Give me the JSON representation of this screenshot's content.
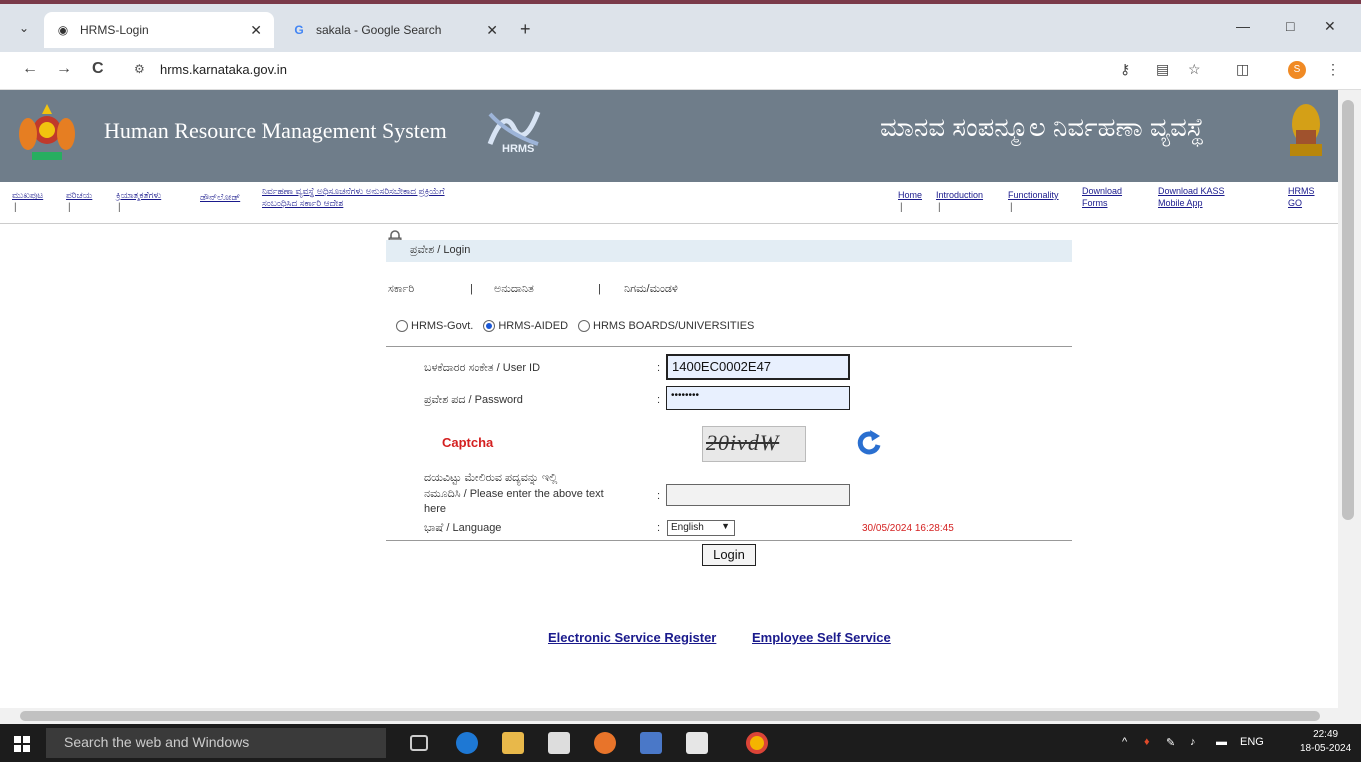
{
  "browser": {
    "tabs": [
      {
        "title": "HRMS-Login",
        "active": true
      },
      {
        "title": "sakala - Google Search",
        "active": false
      }
    ],
    "url": "hrms.karnataka.gov.in",
    "window_controls": {
      "minimize": "—",
      "maximize": "□",
      "close": "✕"
    },
    "nav": {
      "back": "←",
      "forward": "→",
      "reload": "C"
    },
    "profile_initial": "S"
  },
  "banner": {
    "title": "Human Resource Management System",
    "logo_text": "HRMS",
    "title_kannada": "ಮಾನವ ಸಂಪನ್ಮೂಲ ನಿರ್ವಹಣಾ ವ್ಯವಸ್ಥೆ"
  },
  "menu": {
    "left": [
      "ಮುಖಪುಟ",
      "ಪರಿಚಯ",
      "ಕ್ರಿಯಾತ್ಮಕತೆಗಳು",
      "ಡೌನ್‌ಲೋಡ್"
    ],
    "notice_line1": "ನಿರ್ವಹಣಾ ವ್ಯವಸ್ಥೆ ಅಧಿಸೂಚನೆಗಳು ಅನುಸರಿಸಬೇಕಾದ ಪ್ರಕ್ರಿಯೆಗೆ",
    "notice_line2": "ಸಂಬಂಧಿಸಿದ ಸರ್ಕಾರಿ ಆದೇಶ",
    "right": [
      "Home",
      "Introduction",
      "Functionality"
    ],
    "download_forms_1": "Download",
    "download_forms_2": "Forms",
    "kass_1": "Download KASS",
    "kass_2": "Mobile App",
    "hrms_go_1": "HRMS",
    "hrms_go_2": "GO"
  },
  "login": {
    "header": "ಪ್ರವೇಶ / Login",
    "categories": [
      "ಸರ್ಕಾರಿ",
      "ಅನುದಾನಿತ",
      "ನಿಗಮ/ಮಂಡಳಿ"
    ],
    "cat_sep": "|",
    "options": [
      {
        "label": "HRMS-Govt.",
        "selected": false
      },
      {
        "label": "HRMS-AIDED",
        "selected": true
      },
      {
        "label": "HRMS BOARDS/UNIVERSITIES",
        "selected": false
      }
    ],
    "user_id_label": "ಬಳಕೆದಾರರ ಸಂಕೇತ / User ID",
    "user_id_value": "1400EC0002E47",
    "password_label": "ಪ್ರವೇಶ ಪದ / Password",
    "password_value": "••••••••",
    "captcha_label": "Captcha",
    "captcha_text": "20ivdW",
    "captcha_entry_label_1": "ದಯವಿಟ್ಟು ಮೇಲಿರುವ ಪದ್ಯವನ್ನು ಇಲ್ಲಿ",
    "captcha_entry_label_2": "ನಮೂದಿಸಿ / Please enter the above text",
    "captcha_entry_label_3": "here",
    "captcha_entry_value": "",
    "language_label": "ಭಾಷೆ / Language",
    "language_selected": "English",
    "datetime": "30/05/2024 16:28:45",
    "login_button": "Login",
    "colon": ":"
  },
  "links": {
    "esr": "Electronic Service Register",
    "ess": "Employee Self Service"
  },
  "taskbar": {
    "search_placeholder": "Search the web and Windows",
    "lang": "ENG",
    "time": "22:49",
    "date": "18-05-2024"
  },
  "colors": {
    "banner": "#6f7d8a",
    "link": "#1a1a8c",
    "captcha_red": "#d42020",
    "selected_radio": "#1a57d6"
  }
}
